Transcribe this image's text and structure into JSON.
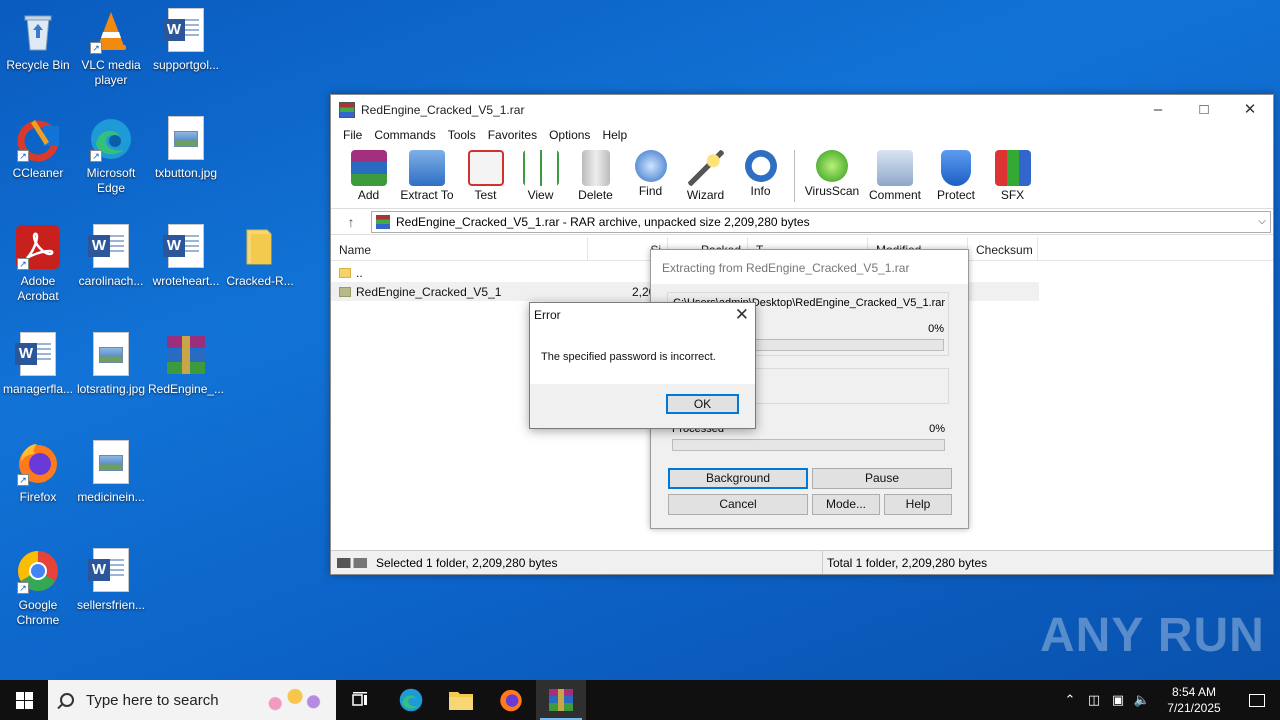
{
  "desktop": {
    "icons": [
      {
        "label": "Recycle Bin",
        "kind": "recycle-bin-icon"
      },
      {
        "label": "VLC media player",
        "kind": "vlc-icon"
      },
      {
        "label": "supportgol...",
        "kind": "word-document-icon"
      },
      {
        "label": "CCleaner",
        "kind": "ccleaner-icon"
      },
      {
        "label": "Microsoft Edge",
        "kind": "edge-icon"
      },
      {
        "label": "txbutton.jpg",
        "kind": "image-file-icon"
      },
      {
        "label": "Adobe Acrobat",
        "kind": "acrobat-icon"
      },
      {
        "label": "carolinach...",
        "kind": "word-document-icon"
      },
      {
        "label": "wroteheart...",
        "kind": "word-document-icon"
      },
      {
        "label": "Cracked-R...",
        "kind": "folder-icon"
      },
      {
        "label": "managerfla...",
        "kind": "word-document-icon"
      },
      {
        "label": "lotsrating.jpg",
        "kind": "image-file-icon"
      },
      {
        "label": "RedEngine_...",
        "kind": "winrar-archive-icon"
      },
      {
        "label": "Firefox",
        "kind": "firefox-icon"
      },
      {
        "label": "medicinein...",
        "kind": "image-file-icon"
      },
      {
        "label": "Google Chrome",
        "kind": "chrome-icon"
      },
      {
        "label": "sellersfrien...",
        "kind": "word-document-icon"
      }
    ]
  },
  "winrar": {
    "title": "RedEngine_Cracked_V5_1.rar",
    "menu": [
      "File",
      "Commands",
      "Tools",
      "Favorites",
      "Options",
      "Help"
    ],
    "toolbar": [
      "Add",
      "Extract To",
      "Test",
      "View",
      "Delete",
      "Find",
      "Wizard",
      "Info",
      "VirusScan",
      "Comment",
      "Protect",
      "SFX"
    ],
    "address": "RedEngine_Cracked_V5_1.rar - RAR archive, unpacked size 2,209,280 bytes",
    "columns": [
      "Name",
      "Si",
      "Packed",
      "T",
      "Modified",
      "Checksum"
    ],
    "rows": [
      {
        "name": "..",
        "size": ""
      },
      {
        "name": "RedEngine_Cracked_V5_1",
        "size": "2,209,2"
      }
    ],
    "status_left": "Selected 1 folder, 2,209,280 bytes",
    "status_right": "Total 1 folder, 2,209,280 bytes"
  },
  "extract_dialog": {
    "title": "Extracting from RedEngine_Cracked_V5_1.rar",
    "path": "C:\\Users\\admin\\Desktop\\RedEngine_Cracked_V5_1.rar",
    "file_percent": "0%",
    "processed_label": "Processed",
    "processed_percent": "0%",
    "buttons": {
      "background": "Background",
      "pause": "Pause",
      "cancel": "Cancel",
      "mode": "Mode...",
      "help": "Help"
    }
  },
  "error_dialog": {
    "title": "Error",
    "message": "The specified password is incorrect.",
    "ok": "OK"
  },
  "watermark": "ANY RUN",
  "taskbar": {
    "search_placeholder": "Type here to search",
    "time": "8:54 AM",
    "date": "7/21/2025"
  }
}
